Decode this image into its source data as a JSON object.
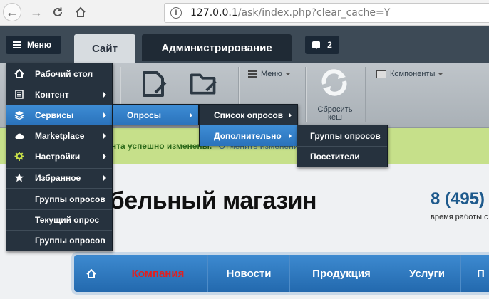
{
  "browser": {
    "url_host": "127.0.0.1",
    "url_path": "/ask/index.php?clear_cache=Y"
  },
  "admin": {
    "menu_label": "Меню",
    "tab_site": "Сайт",
    "tab_admin": "Администрирование",
    "notif_count": "2"
  },
  "toolbar": {
    "menu_label": "Меню",
    "reset_cache_line1": "Сбросить",
    "reset_cache_line2": "кеш",
    "components_label": "Компоненты"
  },
  "notice": {
    "text": "Параметры компонента успешно изменены.",
    "link": "Отменить изменения"
  },
  "site": {
    "title": "Мебельный магазин",
    "phone": "8 (495)",
    "hours": "время работы с"
  },
  "nav": [
    "Компания",
    "Новости",
    "Продукция",
    "Услуги",
    "П"
  ],
  "main_menu": {
    "items": [
      {
        "label": "Рабочий стол",
        "icon": "home-icon"
      },
      {
        "label": "Контент",
        "icon": "document-icon"
      },
      {
        "label": "Сервисы",
        "icon": "layers-icon"
      },
      {
        "label": "Marketplace",
        "icon": "cloud-icon"
      },
      {
        "label": "Настройки",
        "icon": "gear-icon"
      },
      {
        "label": "Избранное",
        "icon": "star-icon"
      }
    ],
    "favorites": [
      "Группы опросов",
      "Текущий опрос",
      "Группы опросов"
    ]
  },
  "services_sub": {
    "item": "Опросы"
  },
  "polls_sub": {
    "items": [
      "Список опросов",
      "Дополнительно"
    ]
  },
  "extra_sub": {
    "items": [
      "Группы опросов",
      "Посетители"
    ]
  },
  "colors": {
    "admin_bg": "#3d4a56",
    "menu_bg": "#26323e",
    "active": "#2f7ac4",
    "notice_bg": "#c6e08a",
    "nav_bg": "#2d78c0"
  }
}
